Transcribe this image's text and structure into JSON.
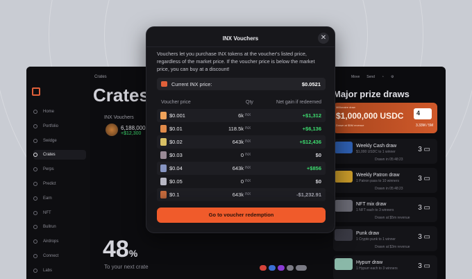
{
  "modal": {
    "title": "INX Vouchers",
    "description": "Vouchers let you purchase INX tokens at the voucher's listed price, regardless of the market price. If the voucher price is below the market price, you can buy at a discount!",
    "current_price_label": "Current INX price:",
    "current_price_value": "$0.0521",
    "columns": [
      "Voucher price",
      "Qty",
      "Net gain if redeemed"
    ],
    "unit": "INX",
    "rows": [
      {
        "price": "$0.001",
        "qty": "6k",
        "gain": "+$1,312",
        "color": "#f0a35a",
        "gain_color": "#3ddc6f"
      },
      {
        "price": "$0.01",
        "qty": "118.5k",
        "gain": "+$6,136",
        "color": "#e08a4a",
        "gain_color": "#3ddc6f"
      },
      {
        "price": "$0.02",
        "qty": "643k",
        "gain": "+$12,436",
        "color": "#d9c065",
        "gain_color": "#3ddc6f"
      },
      {
        "price": "$0.03",
        "qty": "0",
        "gain": "$0",
        "color": "#9a8a96",
        "gain_color": "#d8d8de"
      },
      {
        "price": "$0.04",
        "qty": "643k",
        "gain": "+$856",
        "color": "#8795c2",
        "gain_color": "#3ddc6f"
      },
      {
        "price": "$0.05",
        "qty": "0",
        "gain": "$0",
        "color": "#b7b7c4",
        "gain_color": "#d8d8de"
      },
      {
        "price": "$0.1",
        "qty": "643k",
        "gain": "-$1,232.91",
        "color": "#c56a3c",
        "gain_color": "#a8a8b2"
      }
    ],
    "cta_label": "Go to voucher redemption"
  },
  "background": {
    "nav": [
      "Home",
      "Portfolio",
      "Swidge",
      "Crates",
      "Perps",
      "Predict",
      "Earn",
      "NFT",
      "Bullrun",
      "Airdrops",
      "Connect",
      "Labs"
    ],
    "active_nav": "Crates",
    "breadcrumb": "Crates",
    "title": "Crates",
    "inx_label": "INX Vouchers",
    "inx_amount": "6,188,000",
    "inx_gain": "+$12,300",
    "percent": "48",
    "percent_sign": "%",
    "percent_sub": "To your next crate",
    "right_title": "Major prize draws",
    "top_icons": [
      "Move",
      "Send"
    ],
    "prize": {
      "small": "Millionaire draw",
      "amount": "$1,000,000 USDC",
      "sub": "Drawn at $5M revenue",
      "qty": "4",
      "progress": "3.33M / 5M"
    },
    "draws": [
      {
        "name": "Weekly Cash draw",
        "desc": "$1,000 USDC to 1 winner",
        "foot": "Drawn in 05:48:23",
        "qty": "3",
        "color": "#2e5fb0"
      },
      {
        "name": "Weekly Patron draw",
        "desc": "1 Patron pass to 10 winners",
        "foot": "Drawn in 05:48:23",
        "qty": "3",
        "color": "#c79a2a"
      },
      {
        "name": "NFT mix draw",
        "desc": "1 NFT each to 3 winners",
        "foot": "Drawn at $5m revenue",
        "qty": "3",
        "color": "#6a6a74"
      },
      {
        "name": "Punk draw",
        "desc": "1 Crypto punk to 1 winner",
        "foot": "Drawn at $3m revenue",
        "qty": "3",
        "color": "#3a3a44"
      },
      {
        "name": "Hypurr draw",
        "desc": "1 Hypurr each to 3 winners",
        "foot": "",
        "qty": "3",
        "color": "#8ab8a8"
      }
    ]
  }
}
